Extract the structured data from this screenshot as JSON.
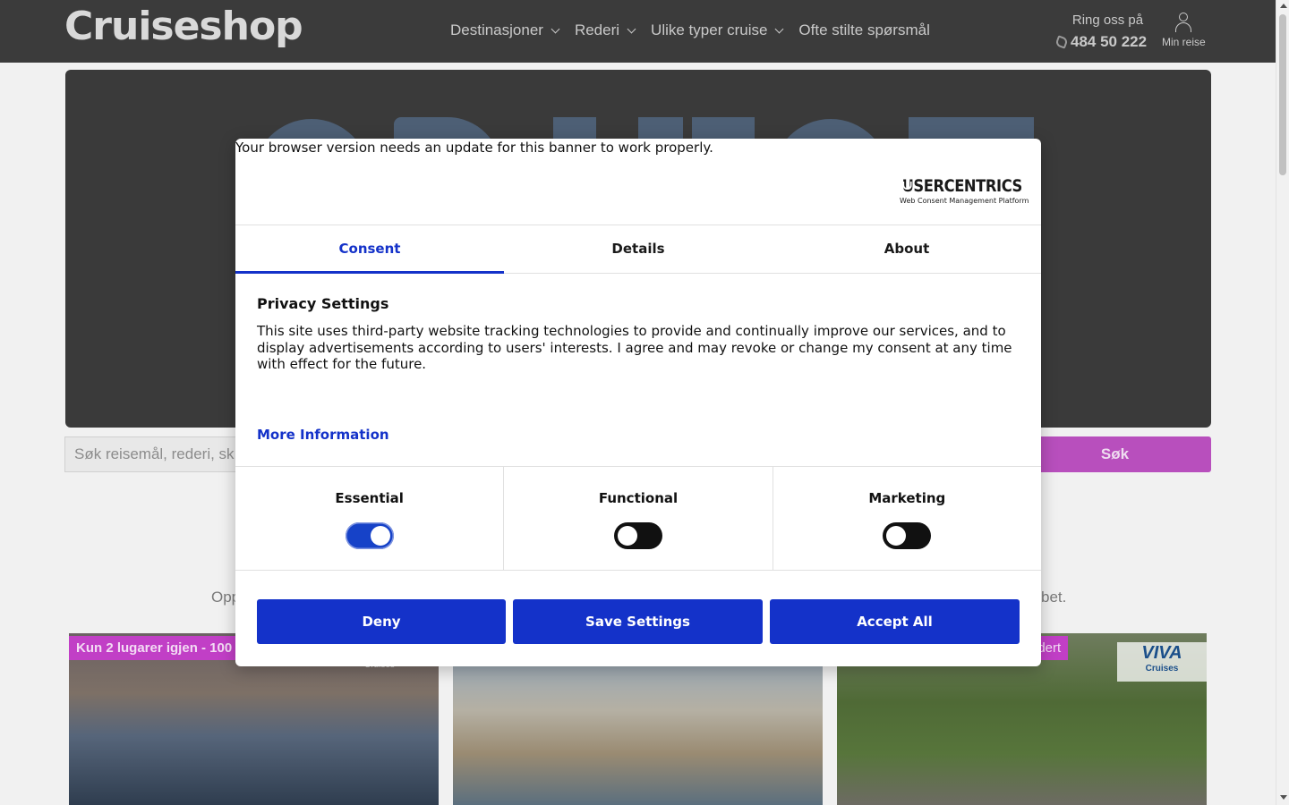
{
  "header": {
    "logo": "Cruiseshop",
    "nav": [
      {
        "label": "Destinasjoner",
        "dropdown": true
      },
      {
        "label": "Rederi",
        "dropdown": true
      },
      {
        "label": "Ulike typer cruise",
        "dropdown": true
      },
      {
        "label": "Ofte stilte spørsmål",
        "dropdown": false
      }
    ],
    "ring_label": "Ring oss på",
    "phone": "484 50 222",
    "account_label": "Min reise"
  },
  "background": {
    "search_placeholder": "Søk reisemål, rederi, sk",
    "search_button": "Søk",
    "intro_left": "Opp",
    "intro_right": "bet.",
    "cards": [
      {
        "badge": "Kun 2 lugarer igjen - 100",
        "logo_text": "Cruises"
      },
      {
        "badge": "",
        "logo_text": ""
      },
      {
        "badge": "udert",
        "logo_text": "VIVA",
        "logo_sub": "Cruises"
      }
    ]
  },
  "dialog": {
    "browser_warning": "Your browser version needs an update for this banner to work properly.",
    "brand": "USERCENTRICS",
    "brand_tagline": "Web Consent Management Platform",
    "tabs": [
      {
        "label": "Consent",
        "active": true
      },
      {
        "label": "Details",
        "active": false
      },
      {
        "label": "About",
        "active": false
      }
    ],
    "privacy_title": "Privacy Settings",
    "privacy_text": "This site uses third-party website tracking technologies to provide and continually improve our services, and to display advertisements according to users' interests. I agree and may revoke or change my consent at any time with effect for the future.",
    "more_info": "More Information",
    "toggles": [
      {
        "label": "Essential",
        "on": true
      },
      {
        "label": "Functional",
        "on": false
      },
      {
        "label": "Marketing",
        "on": false
      }
    ],
    "buttons": {
      "deny": "Deny",
      "save": "Save Settings",
      "accept": "Accept All"
    }
  },
  "colors": {
    "primary": "#1432c9",
    "header_bg": "#3b3b3b",
    "accent_pink": "#c13fc6"
  }
}
